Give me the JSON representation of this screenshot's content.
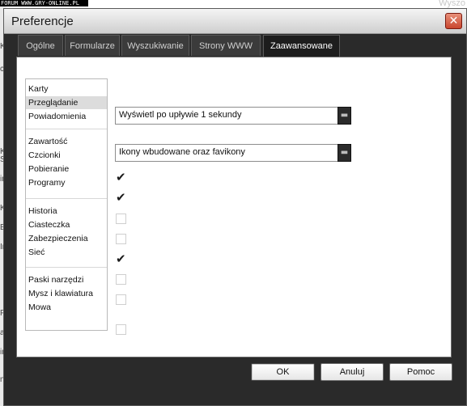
{
  "watermark": {
    "text": "FORUM WWW.GRY-ONLINE.PL",
    "right_text": "Wyszo"
  },
  "background": {
    "letters": [
      "K",
      "co",
      "K",
      "Sa",
      "in",
      "K",
      "Ba",
      "In",
      "Pr",
      "a",
      "in",
      "ne"
    ]
  },
  "window": {
    "title": "Preferencje"
  },
  "tabs": [
    {
      "label": "Ogólne",
      "active": false
    },
    {
      "label": "Formularze",
      "active": false
    },
    {
      "label": "Wyszukiwanie",
      "active": false
    },
    {
      "label": "Strony WWW",
      "active": false
    },
    {
      "label": "Zaawansowane",
      "active": true
    }
  ],
  "sidebar": {
    "groups": [
      [
        "Karty",
        "Przeglądanie",
        "Powiadomienia"
      ],
      [
        "Zawartość",
        "Czcionki",
        "Pobieranie",
        "Programy"
      ],
      [
        "Historia",
        "Ciasteczka",
        "Zabezpieczenia",
        "Sieć"
      ],
      [
        "Paski narzędzi",
        "Mysz i klawiatura",
        "Mowa"
      ]
    ],
    "selected": "Przeglądanie"
  },
  "settings": {
    "dropdowns": [
      {
        "value": "Wyświetl po upływie 1 sekundy"
      },
      {
        "value": "Ikony wbudowane oraz favikony"
      }
    ],
    "checkboxes": [
      {
        "checked": true
      },
      {
        "checked": true
      },
      {
        "checked": false
      },
      {
        "checked": false
      },
      {
        "checked": true
      },
      {
        "checked": false
      },
      {
        "checked": false
      },
      {
        "checked": false
      }
    ]
  },
  "buttons": {
    "ok": "OK",
    "cancel": "Anuluj",
    "help": "Pomoc"
  },
  "icons": {
    "close": "close-icon",
    "dropdown": "chevron-down-icon",
    "check": "checkmark-icon"
  },
  "colors": {
    "window_bg": "#2a2a2a",
    "close_button": "#c9462e",
    "selected_item": "#dcdcdc"
  }
}
